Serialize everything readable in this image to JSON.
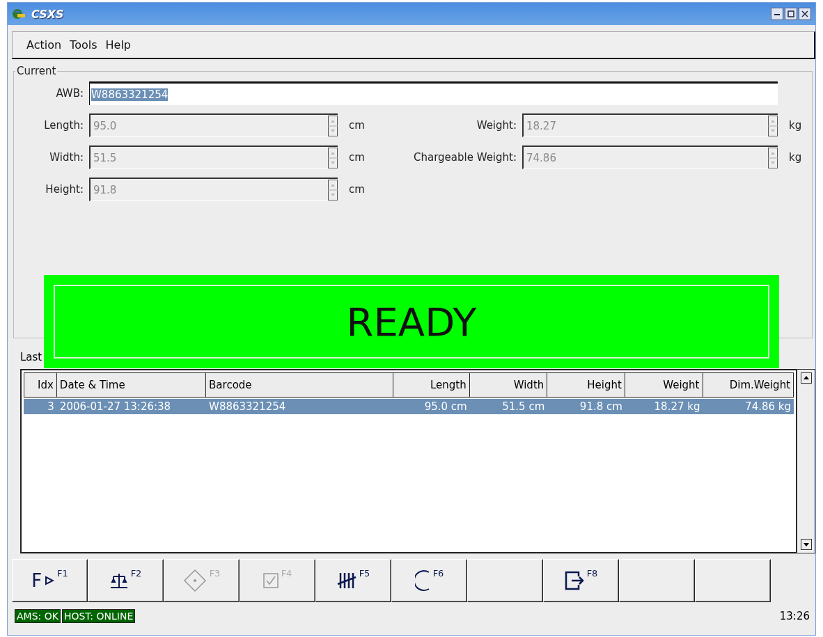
{
  "window": {
    "title": "CSXS"
  },
  "menu": [
    {
      "label": "Action"
    },
    {
      "label": "Tools"
    },
    {
      "label": "Help"
    }
  ],
  "current": {
    "title": "Current",
    "awb": {
      "label": "AWB:",
      "value": "W8863321254",
      "selected": true
    },
    "left_fields": [
      {
        "label": "Length:",
        "value": "95.0",
        "unit": "cm",
        "disabled": true
      },
      {
        "label": "Width:",
        "value": "51.5",
        "unit": "cm",
        "disabled": true
      },
      {
        "label": "Height:",
        "value": "91.8",
        "unit": "cm",
        "disabled": true
      }
    ],
    "right_fields": [
      {
        "label": "Weight:",
        "value": "18.27",
        "unit": "kg",
        "disabled": true
      },
      {
        "label": "Chargeable Weight:",
        "value": "74.86",
        "unit": "kg",
        "disabled": true
      }
    ]
  },
  "banner": {
    "text": "READY",
    "color": "#00ff00"
  },
  "last_tab": {
    "label": "Last"
  },
  "table": {
    "columns": [
      "Idx",
      "Date & Time",
      "Barcode",
      "Length",
      "Width",
      "Height",
      "Weight",
      "Dim.Weight"
    ],
    "rows": [
      {
        "cells": [
          "3",
          "2006-01-27 13:26:38",
          "W8863321254",
          "95.0 cm",
          "51.5 cm",
          "91.8 cm",
          "18.27 kg",
          "74.86 kg"
        ],
        "selected": true
      }
    ]
  },
  "function_keys": [
    {
      "kind": "play",
      "glyph": "F",
      "key": "F1",
      "disabled": false
    },
    {
      "kind": "scale",
      "key": "F2",
      "disabled": false
    },
    {
      "kind": "diamond",
      "key": "F3",
      "disabled": true
    },
    {
      "kind": "check",
      "key": "F4",
      "disabled": true
    },
    {
      "kind": "tally",
      "key": "F5",
      "disabled": false
    },
    {
      "kind": "arc",
      "key": "F6",
      "disabled": false
    },
    {
      "kind": "blank"
    },
    {
      "kind": "exit",
      "key": "F8",
      "disabled": false
    },
    {
      "kind": "blank"
    },
    {
      "kind": "blank"
    }
  ],
  "status_bar": {
    "indicators": [
      "AMS: OK",
      "HOST: ONLINE"
    ],
    "clock": "13:26"
  }
}
